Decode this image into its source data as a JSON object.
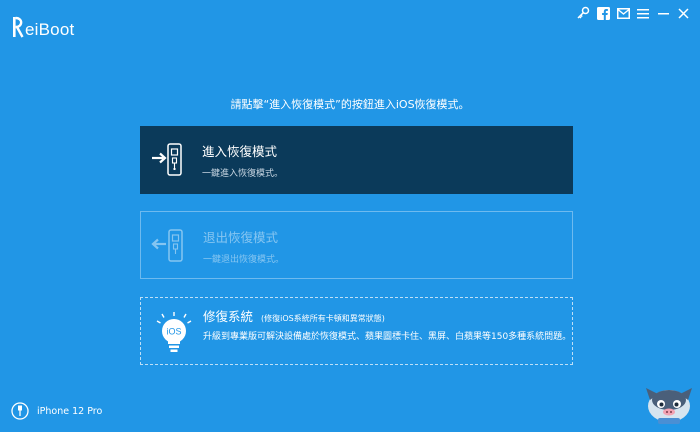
{
  "app": {
    "title": "ReiBoot",
    "title_rest": "eiBoot",
    "accent": "#2196e6",
    "selected_option_bg": "#0b3a5a"
  },
  "titlebar": {
    "icons": [
      "key-icon",
      "facebook-icon",
      "mail-icon",
      "menu-icon",
      "minimize-icon",
      "close-icon"
    ]
  },
  "main": {
    "instruction": "請點擊“進入恢復模式”的按鈕進入iOS恢復模式。",
    "options": [
      {
        "title": "進入恢復模式",
        "description": "一鍵進入恢復模式。",
        "icon": "phone-enter-icon",
        "state": "selected"
      },
      {
        "title": "退出恢復模式",
        "description": "一鍵退出恢復模式。",
        "icon": "phone-exit-icon",
        "state": "disabled"
      },
      {
        "title": "修復系統",
        "subtitle": "(修復iOS系統所有卡頓和異常狀態)",
        "description": "升級到專業版可解決設備處於恢復模式、蘋果圖標卡住、黑屏、白蘋果等150多種系統問題。",
        "icon": "ios-bulb-icon",
        "state": "normal"
      }
    ]
  },
  "footer": {
    "device_name": "iPhone 12 Pro"
  }
}
